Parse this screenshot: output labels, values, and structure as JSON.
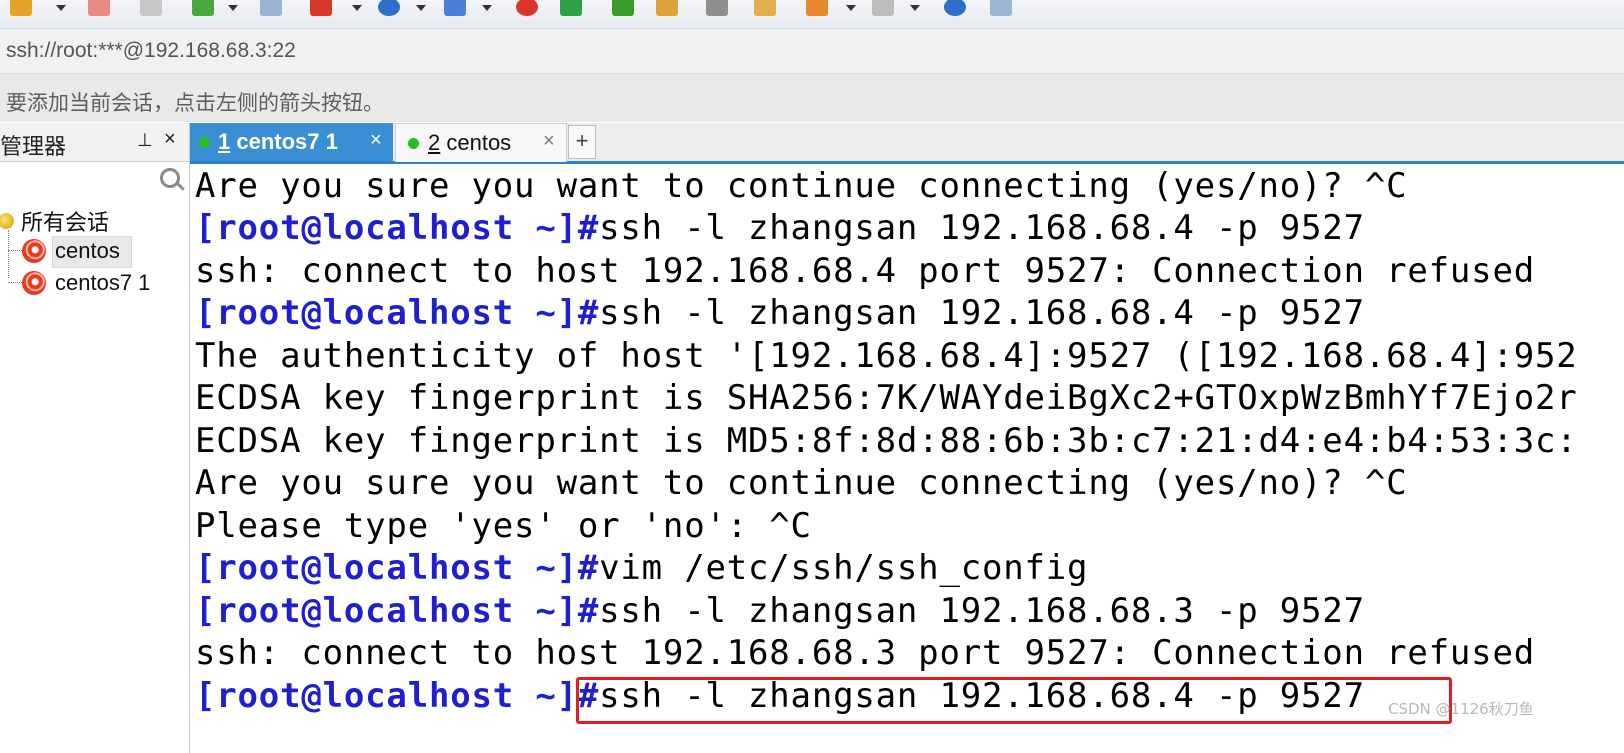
{
  "toolbar": {
    "icons": [
      "folder-icon",
      "disconnect-icon",
      "reconnect-icon",
      "settings-icon",
      "find-icon",
      "layout-icon",
      "globe-icon",
      "font-icon",
      "xftp-icon",
      "xshell-icon",
      "transfer-icon",
      "lock-icon",
      "keyboard-icon",
      "edit-icon",
      "plus-icon",
      "window-icon",
      "help-icon",
      "chat-icon"
    ],
    "colors": {
      "folder": "#e5a32a",
      "red": "#d9362b",
      "green": "#3a9a2a",
      "blue": "#2d6fc9"
    }
  },
  "address": {
    "value": "ssh://root:***@192.168.68.3:22"
  },
  "hint": {
    "text": "要添加当前会话，点击左侧的箭头按钮。"
  },
  "session_manager": {
    "title": "管理器",
    "pin_glyph": "⊥",
    "close_glyph": "×",
    "root_label": "所有会话",
    "items": [
      {
        "label": "centos",
        "selected": true
      },
      {
        "label": "centos7 1",
        "selected": false
      }
    ]
  },
  "tabs": [
    {
      "num": "1",
      "label": " centos7 1",
      "active": true,
      "status_color": "#27c020",
      "close": "×"
    },
    {
      "num": "2",
      "label": " centos",
      "active": false,
      "status_color": "#27c020",
      "close": "×"
    }
  ],
  "tab_add": "+",
  "terminal": {
    "prompt": "[root@localhost ~]#",
    "lines": [
      {
        "prompt": "",
        "text": "Are you sure you want to continue connecting (yes/no)? ^C"
      },
      {
        "prompt": "[root@localhost ~]#",
        "text": "ssh -l zhangsan 192.168.68.4 -p 9527"
      },
      {
        "prompt": "",
        "text": "ssh: connect to host 192.168.68.4 port 9527: Connection refused"
      },
      {
        "prompt": "[root@localhost ~]#",
        "text": "ssh -l zhangsan 192.168.68.4 -p 9527"
      },
      {
        "prompt": "",
        "text": "The authenticity of host '[192.168.68.4]:9527 ([192.168.68.4]:952"
      },
      {
        "prompt": "",
        "text": "ECDSA key fingerprint is SHA256:7K/WAYdeiBgXc2+GTOxpWzBmhYf7Ejo2r"
      },
      {
        "prompt": "",
        "text": "ECDSA key fingerprint is MD5:8f:8d:88:6b:3b:c7:21:d4:e4:b4:53:3c:"
      },
      {
        "prompt": "",
        "text": "Are you sure you want to continue connecting (yes/no)? ^C"
      },
      {
        "prompt": "",
        "text": "Please type 'yes' or 'no': ^C"
      },
      {
        "prompt": "[root@localhost ~]#",
        "text": "vim /etc/ssh/ssh_config"
      },
      {
        "prompt": "[root@localhost ~]#",
        "text": "ssh -l zhangsan 192.168.68.3 -p 9527"
      },
      {
        "prompt": "",
        "text": "ssh: connect to host 192.168.68.3 port 9527: Connection refused"
      },
      {
        "prompt": "[root@localhost ~]#",
        "text": "ssh -l zhangsan 192.168.68.4 -p 9527"
      }
    ],
    "highlight_color": "#e02020"
  },
  "watermark": "CSDN @1126秋刀鱼"
}
